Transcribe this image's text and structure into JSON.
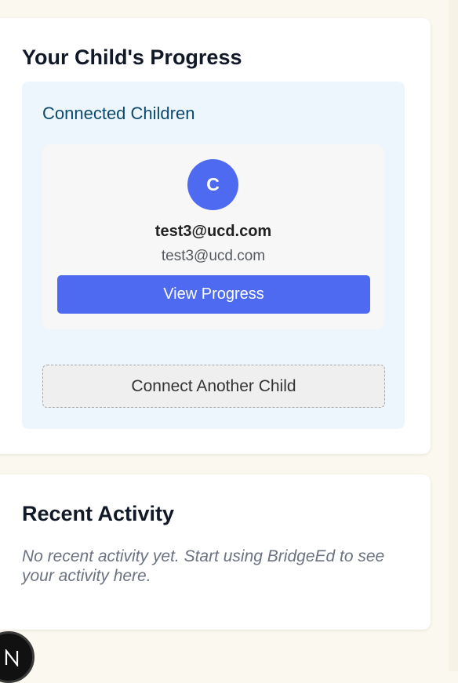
{
  "progress": {
    "title": "Your Child's Progress",
    "connected": {
      "heading": "Connected Children",
      "children": [
        {
          "avatar_initial": "C",
          "name": "test3@ucd.com",
          "email": "test3@ucd.com",
          "view_label": "View Progress"
        }
      ],
      "connect_label": "Connect Another Child"
    }
  },
  "activity": {
    "title": "Recent Activity",
    "empty_text": "No recent activity yet. Start using BridgeEd to see your activity here."
  },
  "dev_badge": {
    "icon": "nextjs-logo-icon"
  },
  "colors": {
    "page_background": "#fbf8ef",
    "accent": "#4d6af0",
    "panel_background": "#eef6fd",
    "panel_heading": "#0b4a6e"
  }
}
